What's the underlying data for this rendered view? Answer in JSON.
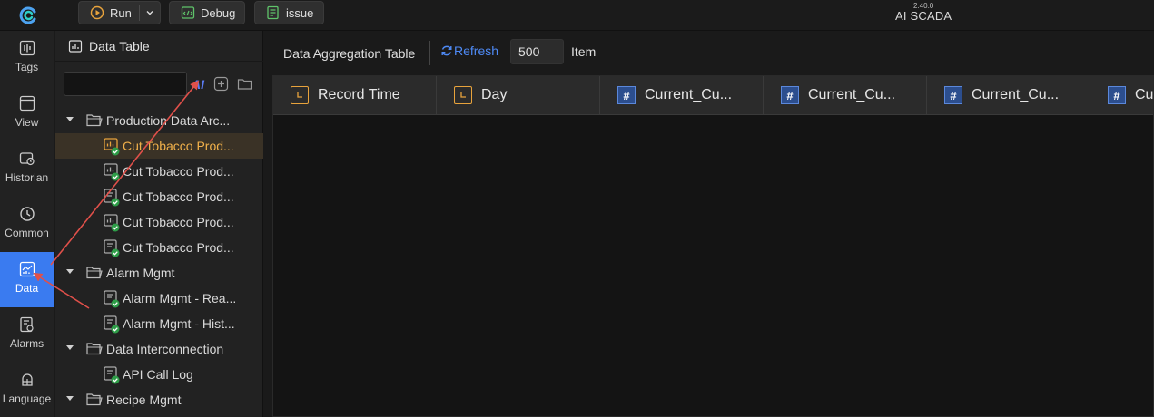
{
  "topbar": {
    "run_label": "Run",
    "debug_label": "Debug",
    "issue_label": "issue",
    "version": "2.40.0",
    "app_title": "AI SCADA"
  },
  "nav": {
    "items": [
      {
        "label": "Tags",
        "icon": "waveform-icon"
      },
      {
        "label": "View",
        "icon": "window-icon"
      },
      {
        "label": "Historian",
        "icon": "history-icon"
      },
      {
        "label": "Common",
        "icon": "clock-icon"
      },
      {
        "label": "Data",
        "icon": "chart-icon",
        "active": true
      },
      {
        "label": "Alarms",
        "icon": "alarm-doc-icon"
      },
      {
        "label": "Language",
        "icon": "language-icon"
      }
    ]
  },
  "panel": {
    "title": "Data Table",
    "search_value": "",
    "ai_label": "AI"
  },
  "tree": [
    {
      "type": "group",
      "label": "Production Data Arc..."
    },
    {
      "type": "leaf",
      "label": "Cut Tobacco Prod...",
      "selected": true
    },
    {
      "type": "leaf",
      "label": "Cut Tobacco Prod..."
    },
    {
      "type": "leaf",
      "label": "Cut Tobacco Prod..."
    },
    {
      "type": "leaf",
      "label": "Cut Tobacco Prod..."
    },
    {
      "type": "leaf",
      "label": "Cut Tobacco Prod..."
    },
    {
      "type": "group",
      "label": "Alarm Mgmt"
    },
    {
      "type": "leaf",
      "label": "Alarm Mgmt - Rea..."
    },
    {
      "type": "leaf",
      "label": "Alarm Mgmt - Hist..."
    },
    {
      "type": "group",
      "label": "Data Interconnection"
    },
    {
      "type": "leaf",
      "label": "API Call Log"
    },
    {
      "type": "group",
      "label": "Recipe Mgmt"
    }
  ],
  "main": {
    "title": "Data Aggregation Table",
    "refresh_label": "Refresh",
    "count_value": "500",
    "item_label": "Item",
    "columns": [
      {
        "label": "Record Time",
        "kind": "time"
      },
      {
        "label": "Day",
        "kind": "time"
      },
      {
        "label": "Current_Cu...",
        "kind": "num"
      },
      {
        "label": "Current_Cu...",
        "kind": "num"
      },
      {
        "label": "Current_Cu...",
        "kind": "num"
      },
      {
        "label": "Cu",
        "kind": "num"
      }
    ]
  },
  "colors": {
    "accent": "#3a7bf0",
    "refresh": "#4e8af5",
    "selected_text": "#f0b04a",
    "annotation_arrow": "#e0504a"
  }
}
